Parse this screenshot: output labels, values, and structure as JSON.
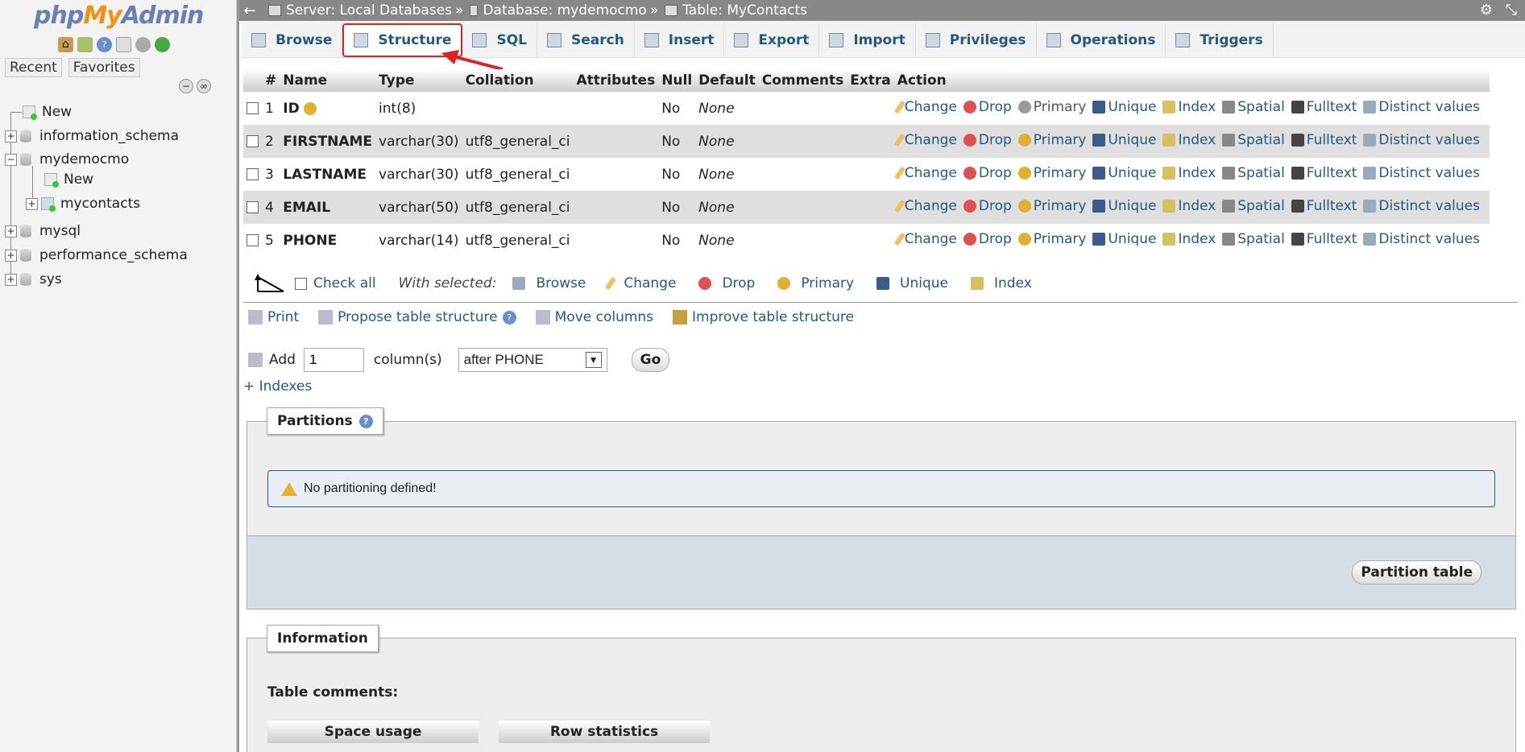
{
  "sidebar": {
    "logo": {
      "php": "php",
      "my": "My",
      "admin": "Admin"
    },
    "recent_label": "Recent",
    "favorites_label": "Favorites",
    "tree": [
      {
        "label": "New",
        "type": "new"
      },
      {
        "label": "information_schema",
        "type": "db"
      },
      {
        "label": "mydemocmo",
        "type": "db"
      },
      {
        "label": "New",
        "type": "new"
      },
      {
        "label": "mycontacts",
        "type": "table"
      },
      {
        "label": "mysql",
        "type": "db"
      },
      {
        "label": "performance_schema",
        "type": "db"
      },
      {
        "label": "sys",
        "type": "db"
      }
    ]
  },
  "breadcrumb": {
    "server": "Server: Local Databases",
    "sep1": "»",
    "database": "Database: mydemocmo",
    "sep2": "»",
    "table": "Table: MyContacts"
  },
  "tabs": [
    {
      "label": "Browse"
    },
    {
      "label": "Structure"
    },
    {
      "label": "SQL"
    },
    {
      "label": "Search"
    },
    {
      "label": "Insert"
    },
    {
      "label": "Export"
    },
    {
      "label": "Import"
    },
    {
      "label": "Privileges"
    },
    {
      "label": "Operations"
    },
    {
      "label": "Triggers"
    }
  ],
  "structure": {
    "headers": [
      "#",
      "Name",
      "Type",
      "Collation",
      "Attributes",
      "Null",
      "Default",
      "Comments",
      "Extra",
      "Action"
    ],
    "rows": [
      {
        "num": "1",
        "name": "ID",
        "type": "int(8)",
        "collation": "",
        "null": "No",
        "default": "None"
      },
      {
        "num": "2",
        "name": "FIRSTNAME",
        "type": "varchar(30)",
        "collation": "utf8_general_ci",
        "null": "No",
        "default": "None"
      },
      {
        "num": "3",
        "name": "LASTNAME",
        "type": "varchar(30)",
        "collation": "utf8_general_ci",
        "null": "No",
        "default": "None"
      },
      {
        "num": "4",
        "name": "EMAIL",
        "type": "varchar(50)",
        "collation": "utf8_general_ci",
        "null": "No",
        "default": "None"
      },
      {
        "num": "5",
        "name": "PHONE",
        "type": "varchar(14)",
        "collation": "utf8_general_ci",
        "null": "No",
        "default": "None"
      }
    ],
    "actions": [
      "Change",
      "Drop",
      "Primary",
      "Unique",
      "Index",
      "Spatial",
      "Fulltext",
      "Distinct values"
    ]
  },
  "with_selected": {
    "check_all": "Check all",
    "label": "With selected:",
    "actions": [
      "Browse",
      "Change",
      "Drop",
      "Primary",
      "Unique",
      "Index"
    ]
  },
  "tools": {
    "print": "Print",
    "propose": "Propose table structure",
    "move": "Move columns",
    "improve": "Improve table structure"
  },
  "add_column": {
    "label": "Add",
    "value": "1",
    "columns_label": "column(s)",
    "position": "after PHONE",
    "go": "Go"
  },
  "indexes_link": "+ Indexes",
  "partitions": {
    "title": "Partitions",
    "notice": "No partitioning defined!",
    "button": "Partition table"
  },
  "information": {
    "title": "Information",
    "table_comments": "Table comments:",
    "space_usage": "Space usage",
    "row_statistics": "Row statistics"
  }
}
